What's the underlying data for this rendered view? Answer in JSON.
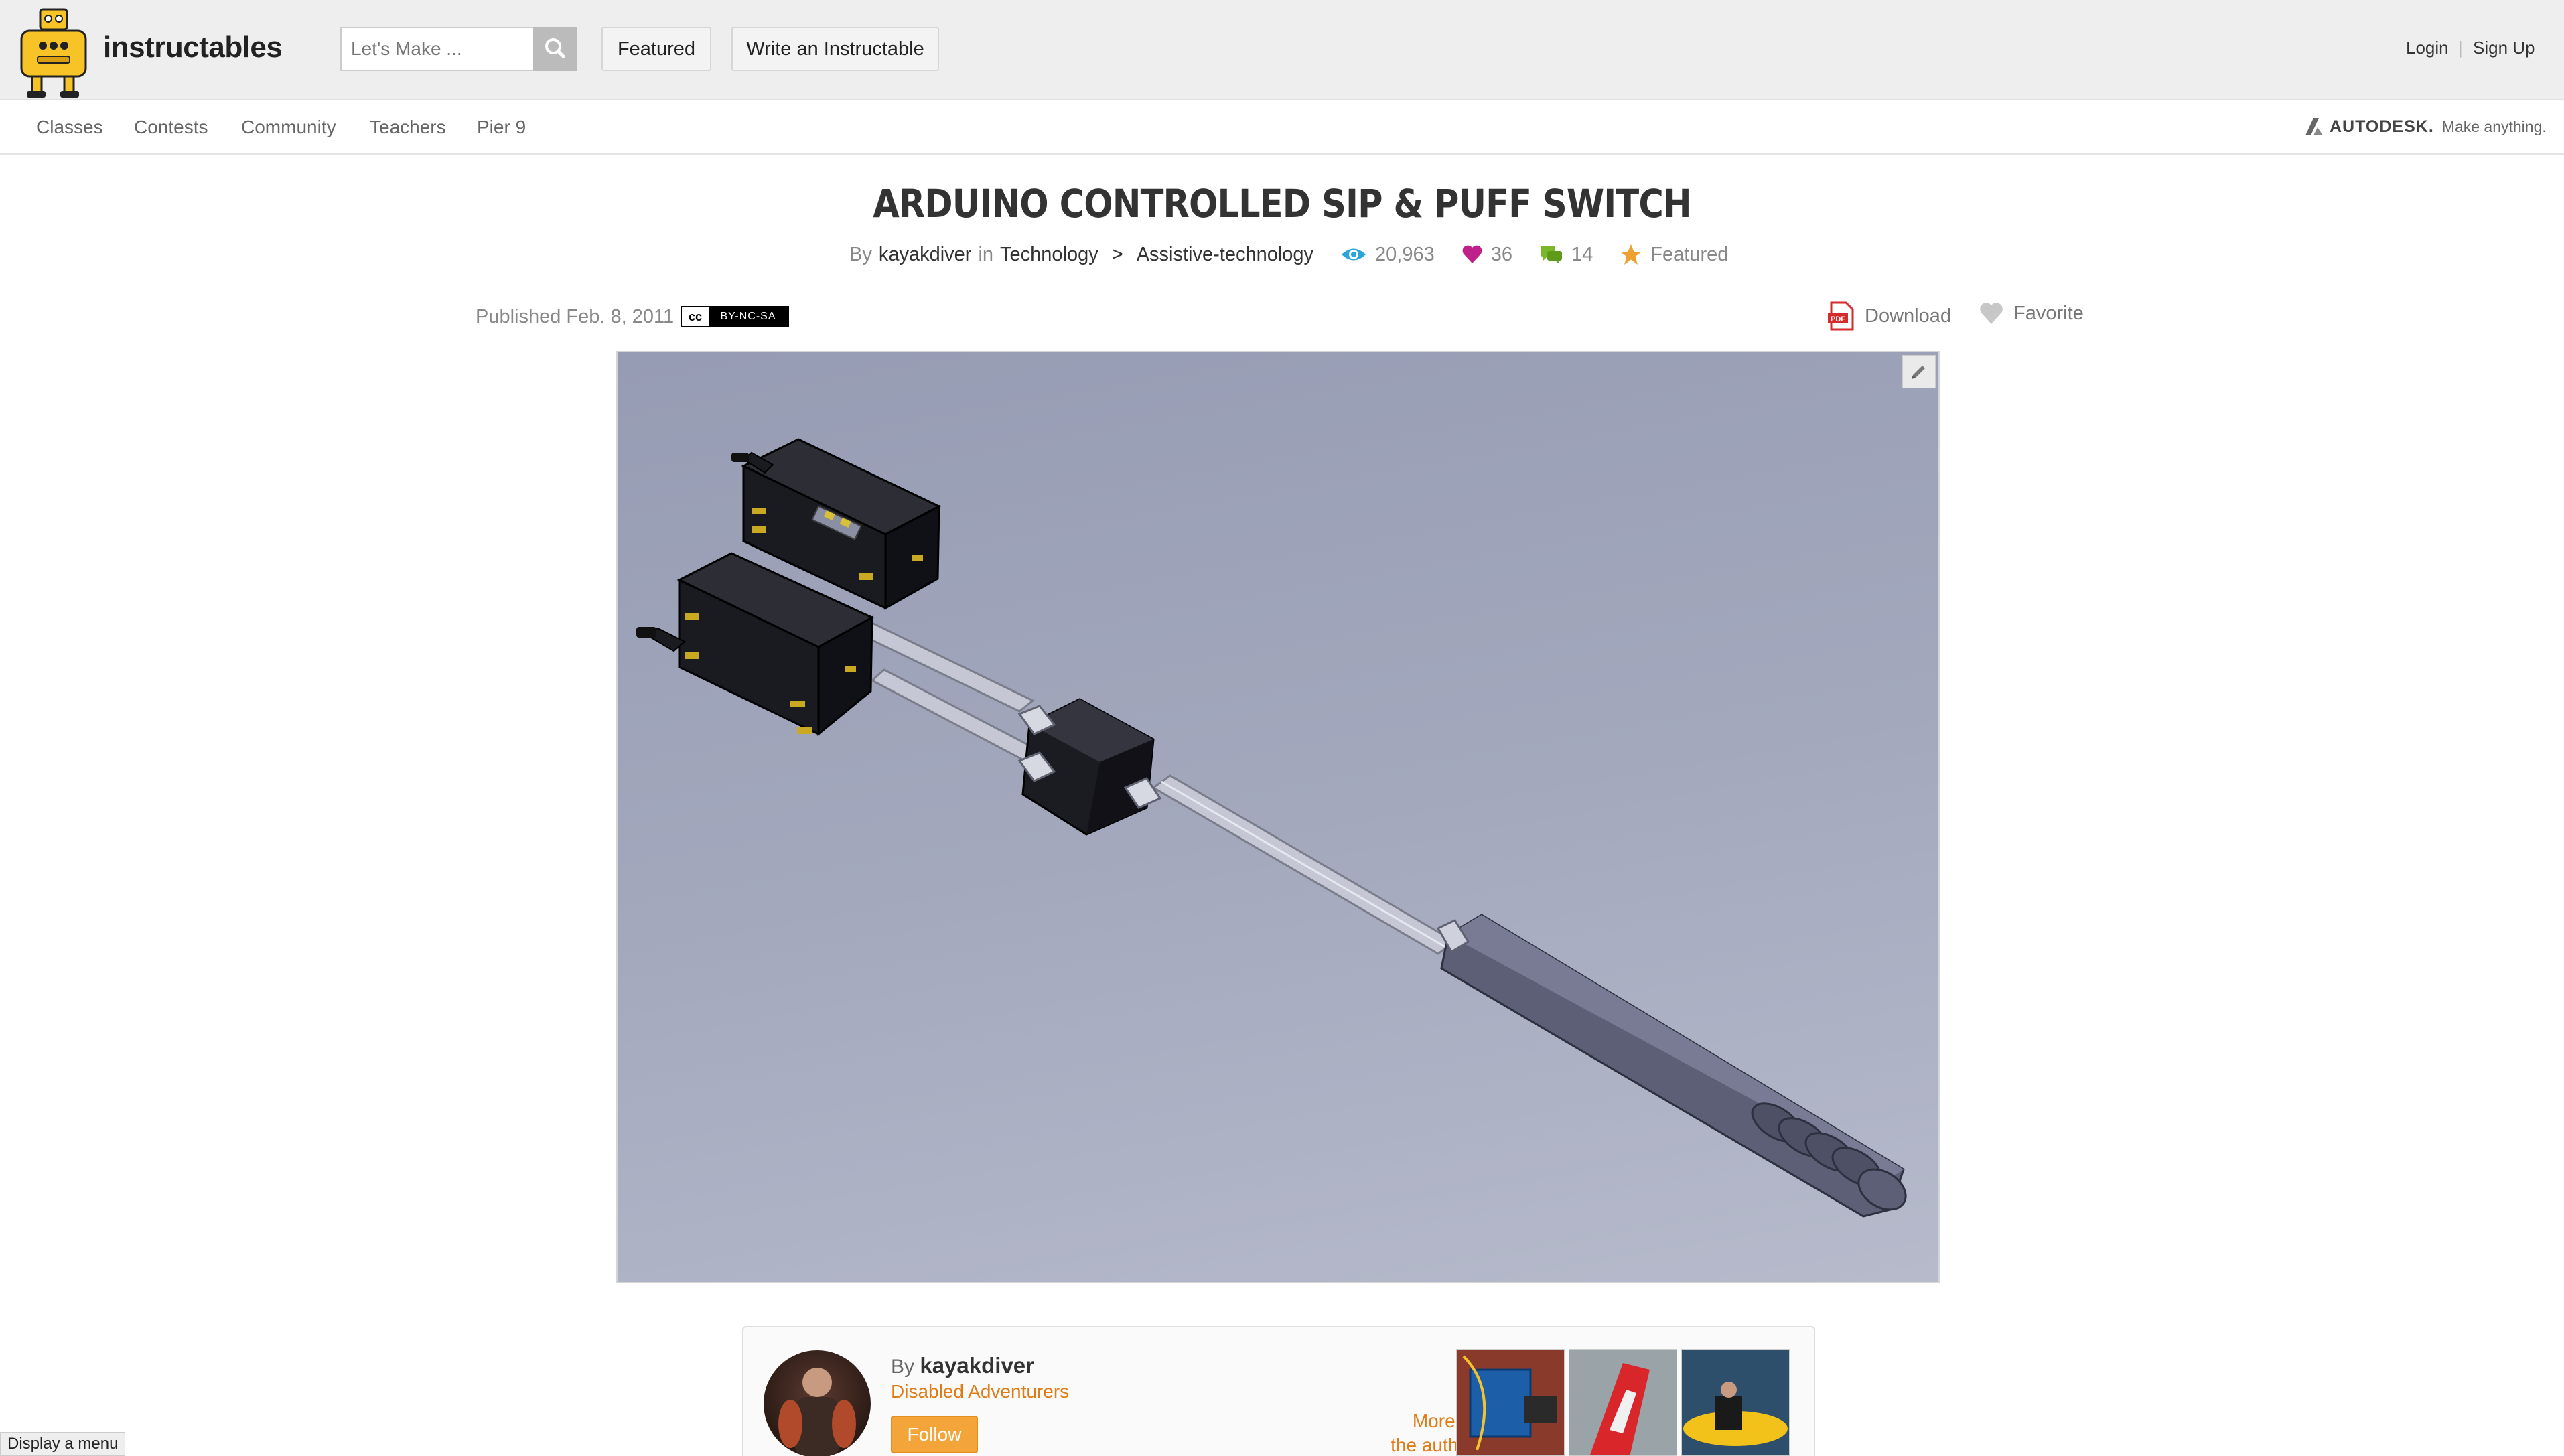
{
  "header": {
    "brand": "instructables",
    "search_placeholder": "Let's Make ...",
    "featured_label": "Featured",
    "write_label": "Write an Instructable",
    "login_label": "Login",
    "separator": "|",
    "signup_label": "Sign Up"
  },
  "nav": {
    "items": [
      "Classes",
      "Contests",
      "Community",
      "Teachers",
      "Pier 9"
    ],
    "autodesk_name": "AUTODESK.",
    "autodesk_tagline": "Make anything."
  },
  "article": {
    "title": "ARDUINO CONTROLLED SIP & PUFF SWITCH",
    "by_prefix": "By",
    "author": "kayakdiver",
    "in_label": "in",
    "category": "Technology",
    "category_sep": ">",
    "subcategory": "Assistive-technology",
    "views": "20,963",
    "favorites": "36",
    "comments": "14",
    "featured_label": "Featured",
    "published": "Published Feb. 8, 2011",
    "license_cc": "cc",
    "license": "BY-NC-SA",
    "download_label": "Download",
    "favorite_label": "Favorite"
  },
  "author_box": {
    "by_prefix": "By",
    "author": "kayakdiver",
    "organization": "Disabled Adventurers",
    "follow_label": "Follow",
    "more_by_line1": "More by",
    "more_by_line2": "the author:"
  },
  "footer": {
    "display_menu": "Display a menu"
  },
  "colors": {
    "accent_orange": "#e07b16",
    "follow_button": "#f4a53a",
    "views_blue": "#2aa7d8",
    "heart_magenta": "#c0208a",
    "comments_green": "#7ab829",
    "star_orange": "#f0a030",
    "header_bg": "#eeeeee"
  },
  "icons": {
    "search": "search-icon",
    "eye": "eye-icon",
    "heart": "heart-icon",
    "comments": "comment-bubbles-icon",
    "star": "star-icon",
    "pdf": "pdf-icon",
    "favorite": "heart-outline-icon",
    "edit": "pencil-icon"
  }
}
